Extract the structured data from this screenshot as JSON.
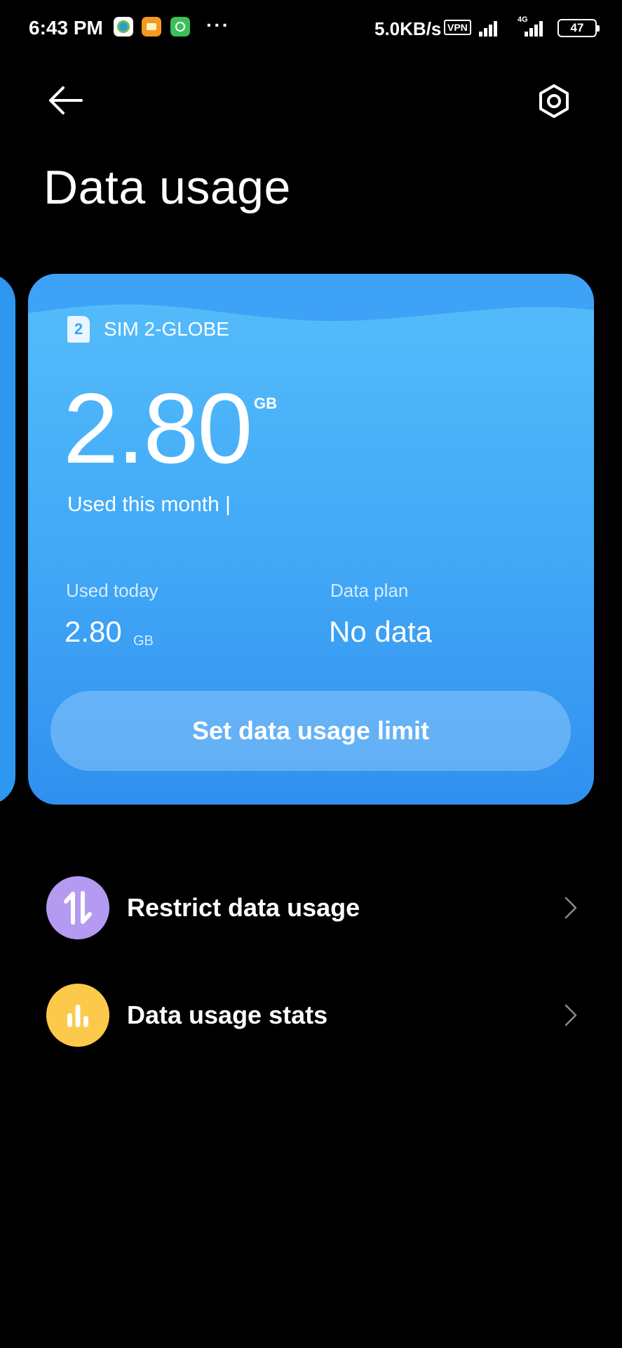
{
  "status_bar": {
    "time": "6:43 PM",
    "more": "···",
    "speed": "5.0KB/s",
    "vpn": "VPN",
    "network_type": "4G",
    "battery": "47",
    "icons": [
      "app-icon",
      "app-icon",
      "app-icon",
      "signal-icon",
      "signal-icon",
      "battery-icon"
    ]
  },
  "header": {
    "title": "Data usage",
    "back_icon": "arrow-left-icon",
    "settings_icon": "gear-icon"
  },
  "sim_card": {
    "sim_number": "2",
    "sim_name": "SIM 2-GLOBE",
    "month_usage_value": "2.80",
    "month_usage_unit": "GB",
    "month_usage_label": "Used this month |",
    "today_label": "Used today",
    "today_value": "2.80",
    "today_unit": "GB",
    "plan_label": "Data plan",
    "plan_value": "No data",
    "limit_button": "Set data usage limit",
    "colors": {
      "card_top": "#56bdfb",
      "card_bottom": "#2f90ef"
    }
  },
  "list": [
    {
      "label": "Restrict data usage",
      "icon": "up-down-arrows-icon",
      "icon_color": "#b49af0"
    },
    {
      "label": "Data usage stats",
      "icon": "bar-chart-icon",
      "icon_color": "#fcc94b"
    }
  ]
}
